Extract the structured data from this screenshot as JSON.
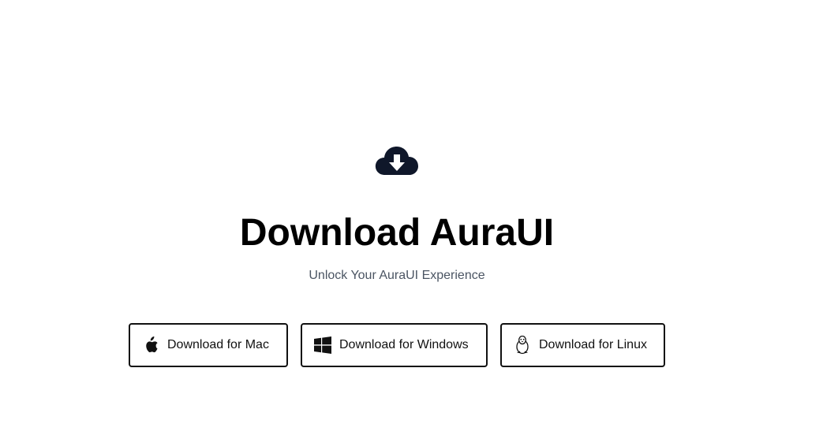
{
  "hero": {
    "icon": "cloud-download-icon",
    "title": "Download AuraUI",
    "subtitle": "Unlock Your AuraUI Experience"
  },
  "downloads": [
    {
      "label": "Download for Mac",
      "icon": "apple-icon"
    },
    {
      "label": "Download for Windows",
      "icon": "windows-icon"
    },
    {
      "label": "Download for Linux",
      "icon": "linux-icon"
    }
  ],
  "colors": {
    "text": "#000000",
    "subtitle": "#4b5563",
    "icon": "#0f172a",
    "border": "#111111"
  }
}
